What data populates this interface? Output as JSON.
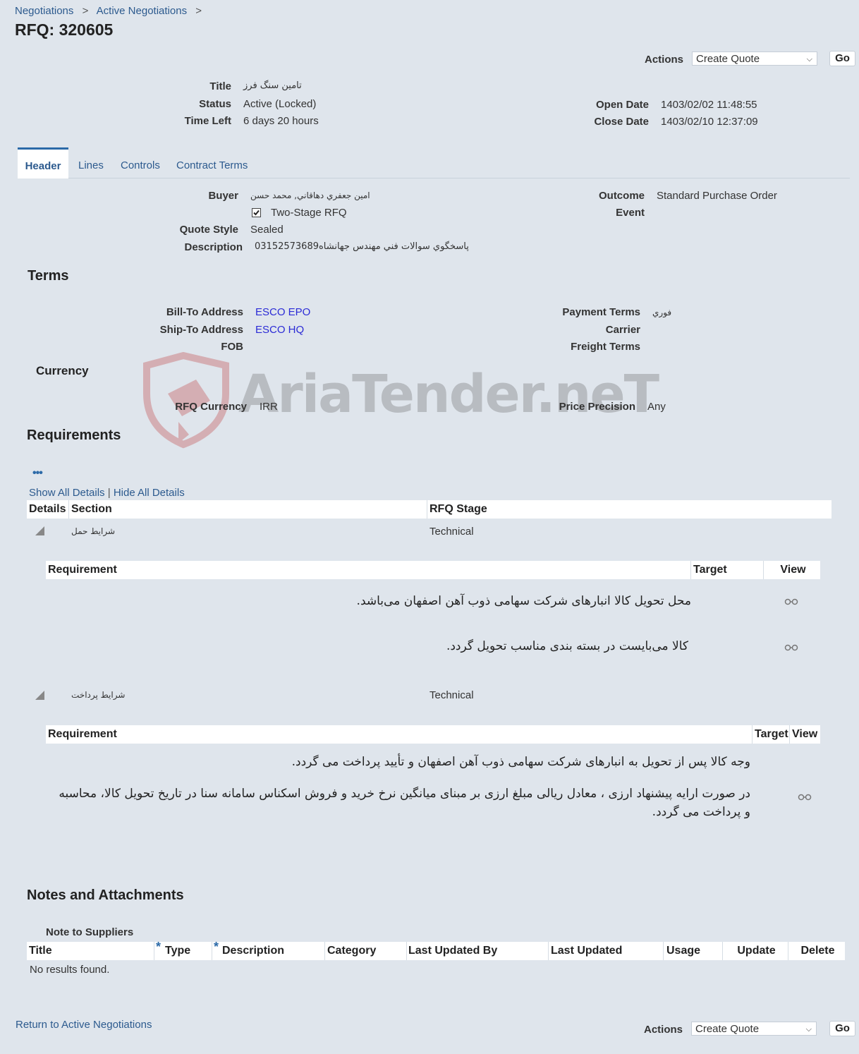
{
  "breadcrumb": {
    "item1": "Negotiations",
    "item2": "Active Negotiations",
    "sep": ">"
  },
  "page_title": "RFQ: 320605",
  "actions": {
    "label": "Actions",
    "select_value": "Create Quote",
    "go": "Go"
  },
  "summary": {
    "title_label": "Title",
    "title_value": "تامين سنگ فرز",
    "status_label": "Status",
    "status_value": "Active (Locked)",
    "time_left_label": "Time Left",
    "time_left_value": "6 days 20 hours",
    "open_date_label": "Open Date",
    "open_date_value": "1403/02/02 11:48:55",
    "close_date_label": "Close Date",
    "close_date_value": "1403/02/10 12:37:09"
  },
  "tabs": [
    "Header",
    "Lines",
    "Controls",
    "Contract Terms"
  ],
  "header": {
    "buyer_label": "Buyer",
    "buyer_value": "امين جعفري دهاقاني, محمد حسن",
    "two_stage_label": "Two-Stage RFQ",
    "quote_style_label": "Quote Style",
    "quote_style_value": "Sealed",
    "description_label": "Description",
    "description_value": "پاسخگوي سوالات فني مهندس جهانشاه03152573689",
    "outcome_label": "Outcome",
    "outcome_value": "Standard Purchase Order",
    "event_label": "Event"
  },
  "terms": {
    "heading": "Terms",
    "bill_to_label": "Bill-To Address",
    "bill_to_value": "ESCO EPO",
    "ship_to_label": "Ship-To Address",
    "ship_to_value": "ESCO HQ",
    "fob_label": "FOB",
    "payment_terms_label": "Payment Terms",
    "payment_terms_value": "فوري",
    "carrier_label": "Carrier",
    "freight_terms_label": "Freight Terms"
  },
  "currency": {
    "heading": "Currency",
    "rfq_currency_label": "RFQ Currency",
    "rfq_currency_value": "IRR",
    "price_precision_label": "Price Precision",
    "price_precision_value": "Any"
  },
  "watermark": {
    "text": "AriaTender.neT"
  },
  "requirements": {
    "heading": "Requirements",
    "more_icon": "•••",
    "show_all": "Show All Details",
    "link_sep": "|",
    "hide_all": "Hide All Details",
    "columns": [
      "Details",
      "Section",
      "RFQ Stage"
    ],
    "sub_columns": [
      "Requirement",
      "Target",
      "View"
    ],
    "sections": [
      {
        "name": "شرايط حمل",
        "stage": "Technical",
        "items": [
          "محل تحویل کالا انبارهای شرکت سهامی ذوب آهن اصفهان می‌باشد.",
          "کالا می‌بایست در بسته بندی مناسب تحویل گردد."
        ]
      },
      {
        "name": "شرايط پرداخت",
        "stage": "Technical",
        "items": [
          "وجه کالا پس از تحویل به انبارهای شرکت سهامی ذوب آهن اصفهان و تأیید پرداخت می گردد.",
          "در صورت ارایه پیشنهاد ارزی ، معادل ریالی مبلغ ارزی بر مبنای میانگین نرخ خرید و فروش اسکناس سامانه سنا در تاریخ تحویل کالا، محاسبه و پرداخت می گردد."
        ]
      }
    ]
  },
  "notes": {
    "heading": "Notes and Attachments",
    "note_to_suppliers": "Note to Suppliers",
    "columns": [
      "Title",
      "Type",
      "Description",
      "Category",
      "Last Updated By",
      "Last Updated",
      "Usage",
      "Update",
      "Delete"
    ],
    "required_mark": "*",
    "empty": "No results found."
  },
  "footer": {
    "return_link": "Return to Active Negotiations"
  },
  "colors": {
    "link": "#2c5a8e",
    "page_bg": "#dfe5ec",
    "tab_accent": "#2c6aa8"
  },
  "icons": {
    "checkbox": "checkbox-checked-icon",
    "expand": "expand-triangle-icon",
    "view": "glasses-icon",
    "dropdown": "chevron-down-icon"
  }
}
